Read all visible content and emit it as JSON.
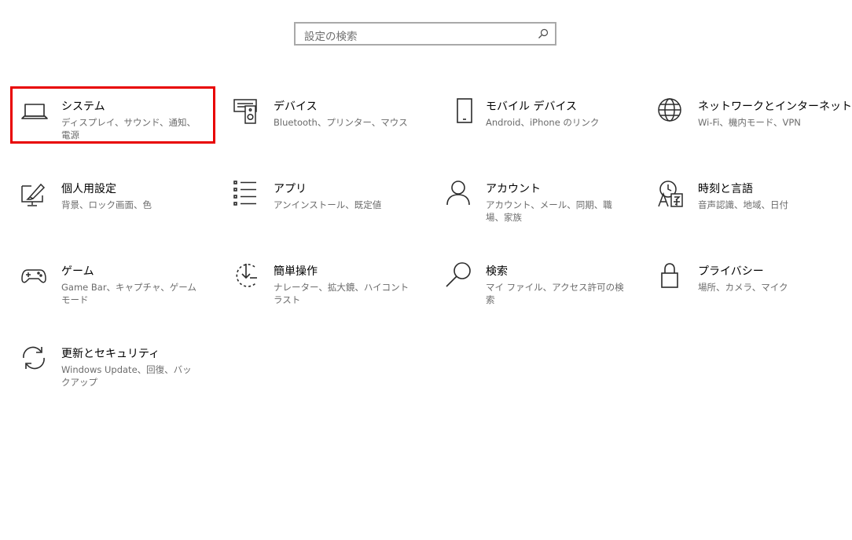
{
  "search": {
    "placeholder": "設定の検索",
    "icon": "search-icon"
  },
  "tiles": [
    {
      "title": "システム",
      "desc": "ディスプレイ、サウンド、通知、電源",
      "icon": "laptop-icon"
    },
    {
      "title": "デバイス",
      "desc": "Bluetooth、プリンター、マウス",
      "icon": "devices-icon"
    },
    {
      "title": "モバイル デバイス",
      "desc": "Android、iPhone のリンク",
      "icon": "phone-icon"
    },
    {
      "title": "ネットワークとインターネット",
      "desc": "Wi-Fi、機内モード、VPN",
      "icon": "globe-icon"
    },
    {
      "title": "個人用設定",
      "desc": "背景、ロック画面、色",
      "icon": "personalization-icon"
    },
    {
      "title": "アプリ",
      "desc": "アンインストール、既定値",
      "icon": "apps-list-icon"
    },
    {
      "title": "アカウント",
      "desc": "アカウント、メール、同期、職場、家族",
      "icon": "person-icon"
    },
    {
      "title": "時刻と言語",
      "desc": "音声認識、地域、日付",
      "icon": "time-language-icon"
    },
    {
      "title": "ゲーム",
      "desc": "Game Bar、キャプチャ、ゲーム モード",
      "icon": "gamepad-icon"
    },
    {
      "title": "簡単操作",
      "desc": "ナレーター、拡大鏡、ハイコントラスト",
      "icon": "ease-of-access-icon"
    },
    {
      "title": "検索",
      "desc": "マイ ファイル、アクセス許可の検索",
      "icon": "magnifier-icon"
    },
    {
      "title": "プライバシー",
      "desc": "場所、カメラ、マイク",
      "icon": "lock-icon"
    },
    {
      "title": "更新とセキュリティ",
      "desc": "Windows Update、回復、バックアップ",
      "icon": "update-icon"
    }
  ],
  "colors": {
    "highlight": "#e80000",
    "title_text": "#000000",
    "desc_text": "#6b6b6b",
    "icon_stroke": "#2b2b2b"
  }
}
